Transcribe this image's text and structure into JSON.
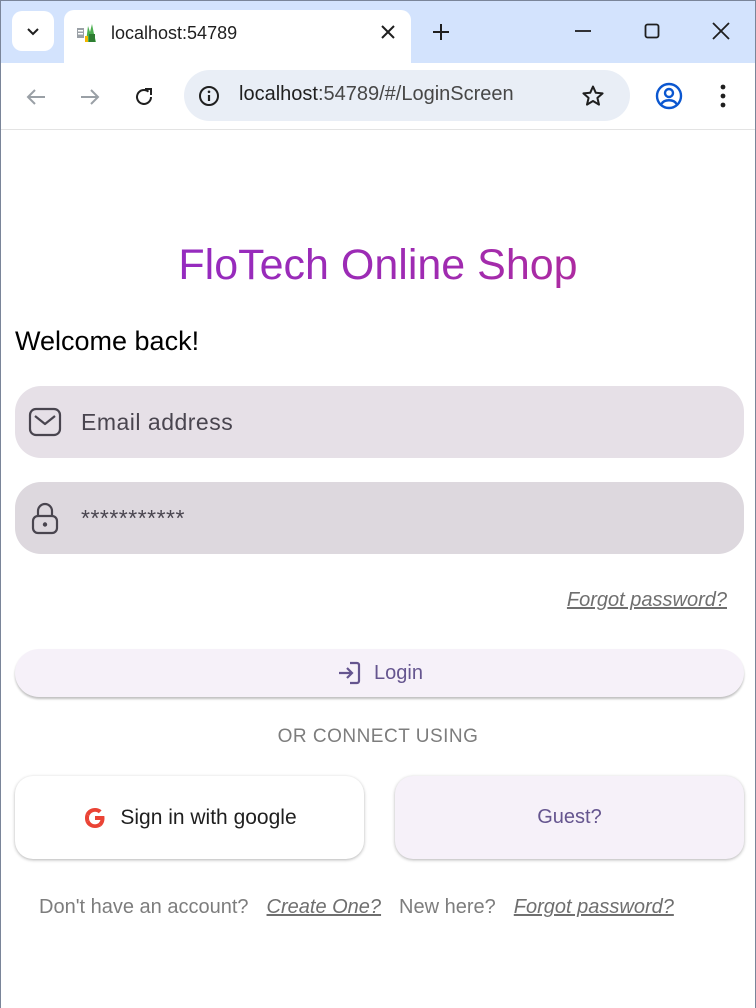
{
  "browser": {
    "tab_title": "localhost:54789",
    "url_host": "localhost",
    "url_rest": ":54789/#/LoginScreen"
  },
  "page": {
    "title": "FloTech Online Shop",
    "welcome": "Welcome back!",
    "email_placeholder": "Email address",
    "password_value": "***********",
    "forgot_top": "Forgot password?",
    "login_label": "Login",
    "or_text": "OR CONNECT USING",
    "google_label": "Sign in with google",
    "guest_label": "Guest?",
    "no_account": "Don't have an account?",
    "create_one": "Create One?",
    "new_here": "New here?",
    "forgot_bottom": "Forgot password?"
  },
  "colors": {
    "title_gradient": [
      "#8e2bc9",
      "#c02a8a"
    ],
    "accent": "#65558f",
    "tabstrip": "#d3e3fd"
  }
}
